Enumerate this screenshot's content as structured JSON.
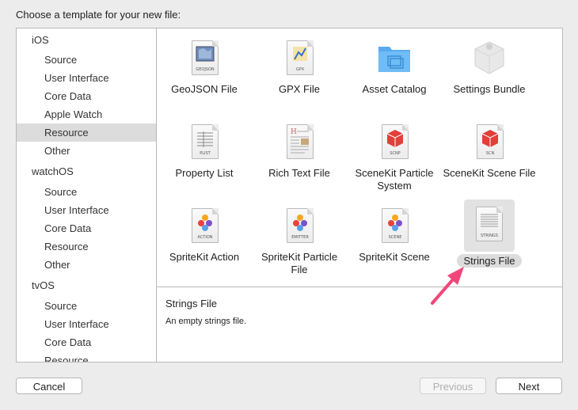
{
  "prompt": "Choose a template for your new file:",
  "sidebar": {
    "groups": [
      {
        "platform": "iOS",
        "items": [
          "Source",
          "User Interface",
          "Core Data",
          "Apple Watch",
          "Resource",
          "Other"
        ]
      },
      {
        "platform": "watchOS",
        "items": [
          "Source",
          "User Interface",
          "Core Data",
          "Resource",
          "Other"
        ]
      },
      {
        "platform": "tvOS",
        "items": [
          "Source",
          "User Interface",
          "Core Data",
          "Resource"
        ]
      }
    ],
    "selected": "iOS/Resource"
  },
  "templates": [
    {
      "label": "GeoJSON File",
      "icon": "geojson-file-icon",
      "tag": "GEOJSON"
    },
    {
      "label": "GPX File",
      "icon": "gpx-file-icon",
      "tag": "GPX"
    },
    {
      "label": "Asset Catalog",
      "icon": "asset-catalog-folder-icon",
      "tag": ""
    },
    {
      "label": "Settings Bundle",
      "icon": "settings-bundle-icon",
      "tag": ""
    },
    {
      "label": "Property List",
      "icon": "property-list-icon",
      "tag": "PLIST"
    },
    {
      "label": "Rich Text File",
      "icon": "rich-text-file-icon",
      "tag": ""
    },
    {
      "label": "SceneKit Particle System",
      "icon": "scenekit-particle-icon",
      "tag": "SCNP"
    },
    {
      "label": "SceneKit Scene File",
      "icon": "scenekit-scene-icon",
      "tag": "SCN"
    },
    {
      "label": "SpriteKit Action",
      "icon": "spritekit-action-icon",
      "tag": "ACTION"
    },
    {
      "label": "SpriteKit Particle File",
      "icon": "spritekit-particle-icon",
      "tag": "EMITTER"
    },
    {
      "label": "SpriteKit Scene",
      "icon": "spritekit-scene-icon",
      "tag": "SCENE"
    },
    {
      "label": "Strings File",
      "icon": "strings-file-icon",
      "tag": "STRINGS"
    }
  ],
  "selected_template": "Strings File",
  "description": {
    "title": "Strings File",
    "text": "An empty strings file."
  },
  "buttons": {
    "cancel": "Cancel",
    "previous": "Previous",
    "next": "Next"
  },
  "annotation": {
    "arrow_color": "#f2457a",
    "points_to": "Strings File"
  }
}
